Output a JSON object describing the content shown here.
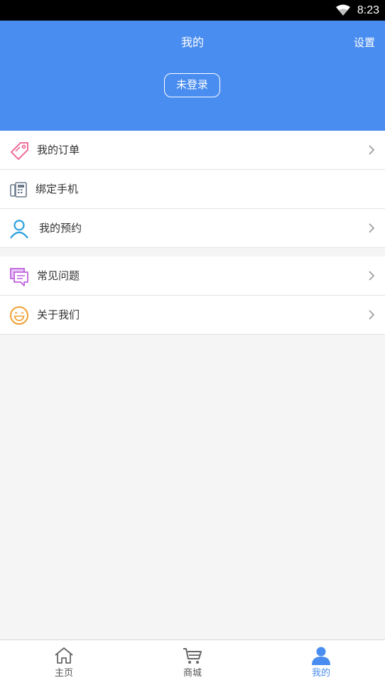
{
  "status_bar": {
    "time": "8:23"
  },
  "header": {
    "title": "我的",
    "settings_label": "设置",
    "login_label": "未登录"
  },
  "menu_group_1": [
    {
      "label": "我的订单",
      "icon": "tag-icon",
      "color": "#f06f9a"
    },
    {
      "label": "绑定手机",
      "icon": "phone-icon",
      "color": "#6a7a8a"
    },
    {
      "label": "我的预约",
      "icon": "person-icon",
      "color": "#2a9fe0"
    }
  ],
  "menu_group_2": [
    {
      "label": "常见问题",
      "icon": "chat-bubble-icon",
      "color": "#c060e0"
    },
    {
      "label": "关于我们",
      "icon": "smiley-icon",
      "color": "#f0a030"
    }
  ],
  "tabs": [
    {
      "label": "主页",
      "icon": "home-icon"
    },
    {
      "label": "商城",
      "icon": "cart-icon"
    },
    {
      "label": "我的",
      "icon": "user-icon",
      "active": true
    }
  ],
  "colors": {
    "accent": "#4a8df0",
    "background": "#f5f5f5",
    "divider": "#e3e3e3"
  }
}
